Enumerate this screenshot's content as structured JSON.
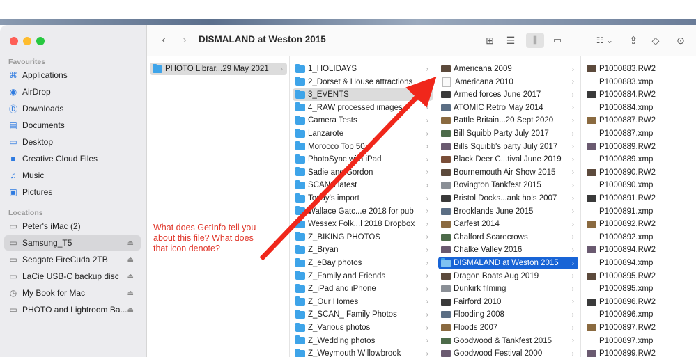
{
  "window_title": "DISMALAND at Weston 2015",
  "sidebar": {
    "favourites_heading": "Favourites",
    "favourites": [
      {
        "label": "Applications",
        "icon": "applications-icon"
      },
      {
        "label": "AirDrop",
        "icon": "airdrop-icon"
      },
      {
        "label": "Downloads",
        "icon": "downloads-icon"
      },
      {
        "label": "Documents",
        "icon": "documents-icon"
      },
      {
        "label": "Desktop",
        "icon": "desktop-icon"
      },
      {
        "label": "Creative Cloud Files",
        "icon": "folder-icon"
      },
      {
        "label": "Music",
        "icon": "music-icon"
      },
      {
        "label": "Pictures",
        "icon": "pictures-icon"
      }
    ],
    "locations_heading": "Locations",
    "locations": [
      {
        "label": "Peter's iMac (2)",
        "icon": "computer-icon",
        "eject": false
      },
      {
        "label": "Samsung_T5",
        "icon": "disk-icon",
        "eject": true,
        "selected": true
      },
      {
        "label": "Seagate FireCuda 2TB",
        "icon": "disk-icon",
        "eject": true
      },
      {
        "label": "LaCie USB-C backup disc",
        "icon": "disk-icon",
        "eject": true
      },
      {
        "label": "My Book for Mac",
        "icon": "timemachine-icon",
        "eject": true
      },
      {
        "label": "PHOTO and Lightroom Ba...",
        "icon": "disk-icon",
        "eject": true
      }
    ]
  },
  "columns": {
    "col1": [
      "PHOTO Librar...29 May 2021"
    ],
    "col2": [
      "1_HOLIDAYS",
      "2_Dorset & House attractions",
      "3_EVENTS",
      "4_RAW processed images",
      "Camera Tests",
      "Lanzarote",
      "Morocco Top 50",
      "PhotoSync with iPad",
      "Sadie and Gordon",
      "SCANS latest",
      "Today's import",
      "Wallace Gatc...e 2018 for pub",
      "Wessex Folk...l 2018 Dropbox",
      "Z_BIKING PHOTOS",
      "Z_Bryan",
      "Z_eBay photos",
      "Z_Family and Friends",
      "Z_iPad and iPhone",
      "Z_Our Homes",
      "Z_SCAN_ Family Photos",
      "Z_Various photos",
      "Z_Wedding photos",
      "Z_Weymouth Willowbrook"
    ],
    "col3": [
      "Americana 2009",
      "Americana 2010",
      "Armed forces June 2017",
      "ATOMIC Retro May 2014",
      "Battle Britain...20 Sept 2020",
      "Bill Squibb Party July 2017",
      "Bills Squibb's party July 2017",
      "Black Deer C...tival June 2019",
      "Bournemouth Air Show 2015",
      "Bovington Tankfest 2015",
      "Bristol Docks...ank hols 2007",
      "Brooklands June 2015",
      "Carfest 2014",
      "Chalford Scarecrows",
      "Chalke Valley 2016",
      "DISMALAND at Weston 2015",
      "Dragon Boats Aug 2019",
      "Dunkirk filming",
      "Fairford 2010",
      "Flooding 2008",
      "Floods 2007",
      "Goodwood & Tankfest 2015",
      "Goodwood Festival 2000"
    ],
    "col4": [
      "P1000883.RW2",
      "P1000883.xmp",
      "P1000884.RW2",
      "P1000884.xmp",
      "P1000887.RW2",
      "P1000887.xmp",
      "P1000889.RW2",
      "P1000889.xmp",
      "P1000890.RW2",
      "P1000890.xmp",
      "P1000891.RW2",
      "P1000891.xmp",
      "P1000892.RW2",
      "P1000892.xmp",
      "P1000894.RW2",
      "P1000894.xmp",
      "P1000895.RW2",
      "P1000895.xmp",
      "P1000896.RW2",
      "P1000896.xmp",
      "P1000897.RW2",
      "P1000897.xmp",
      "P1000899.RW2"
    ]
  },
  "annotation": "What does GetInfo tell you about this file? What does that icon denote?",
  "colors": {
    "accent": "#1864d6",
    "folder": "#3ea4e9",
    "annotation": "#e0362a"
  }
}
